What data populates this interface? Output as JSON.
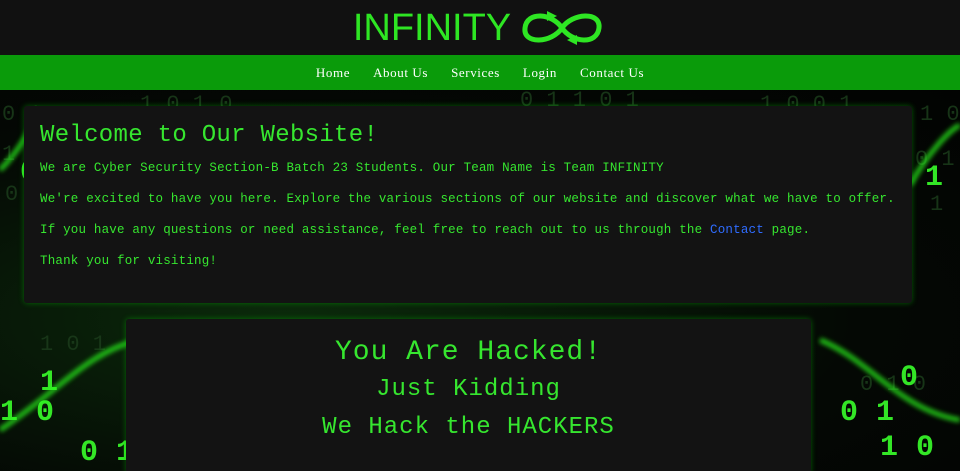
{
  "header": {
    "logo_text": "INFINITY",
    "logo_icon": "infinity-arrows-icon"
  },
  "nav": {
    "items": [
      {
        "label": "Home"
      },
      {
        "label": "About Us"
      },
      {
        "label": "Services"
      },
      {
        "label": "Login"
      },
      {
        "label": "Contact Us"
      }
    ]
  },
  "welcome": {
    "title": "Welcome to Our Website!",
    "p1": "We are Cyber Security Section-B Batch 23 Students. Our Team Name is Team INFINITY",
    "p2": "We're excited to have you here. Explore the various sections of our website and discover what we have to offer.",
    "p3_before": "If you have any questions or need assistance, feel free to reach out to us through the ",
    "p3_link": "Contact",
    "p3_after": " page.",
    "p4": "Thank you for visiting!"
  },
  "hacked": {
    "line1": "You Are Hacked!",
    "line2": "Just Kidding",
    "line3": "We Hack the HACKERS"
  },
  "colors": {
    "accent_green": "#36e62f",
    "nav_green": "#0a9b0a",
    "link_blue": "#2f6cff",
    "panel_bg": "#131313",
    "header_bg": "#111111"
  }
}
